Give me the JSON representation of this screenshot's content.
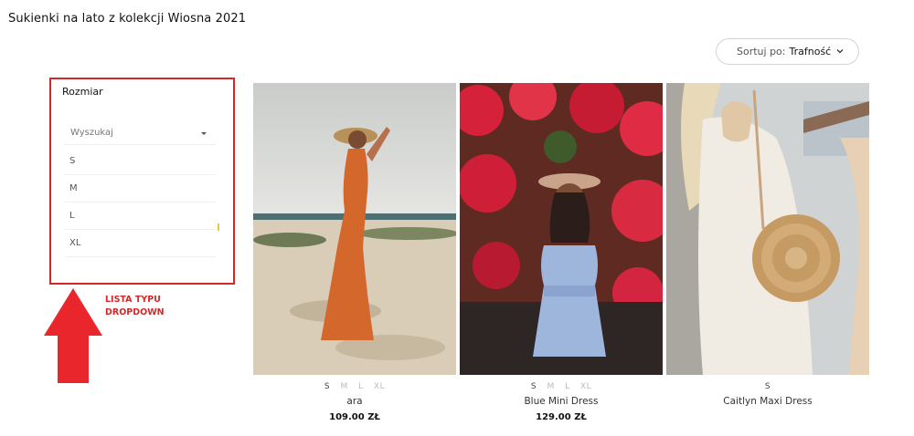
{
  "page": {
    "title": "Sukienki na lato z kolekcji Wiosna 2021"
  },
  "sort": {
    "label": "Sortuj po:",
    "value": "Trafność",
    "icon": "chevron-down-icon"
  },
  "filter": {
    "heading": "Rozmiar",
    "search_placeholder": "Wyszukaj",
    "options": [
      "S",
      "M",
      "L",
      "XL"
    ]
  },
  "annotation": {
    "line1": "LISTA TYPU",
    "line2": "DROPDOWN",
    "color": "#d42828"
  },
  "products": [
    {
      "name": "ara",
      "price": "109.00 ZŁ",
      "sizes": [
        {
          "label": "S",
          "available": true
        },
        {
          "label": "M",
          "available": false
        },
        {
          "label": "L",
          "available": false
        },
        {
          "label": "XL",
          "available": false
        }
      ]
    },
    {
      "name": "Blue Mini Dress",
      "price": "129.00 ZŁ",
      "sizes": [
        {
          "label": "S",
          "available": true
        },
        {
          "label": "M",
          "available": false
        },
        {
          "label": "L",
          "available": false
        },
        {
          "label": "XL",
          "available": false
        }
      ]
    },
    {
      "name": "Caitlyn Maxi Dress",
      "price": "",
      "sizes": [
        {
          "label": "S",
          "available": true
        }
      ]
    }
  ]
}
